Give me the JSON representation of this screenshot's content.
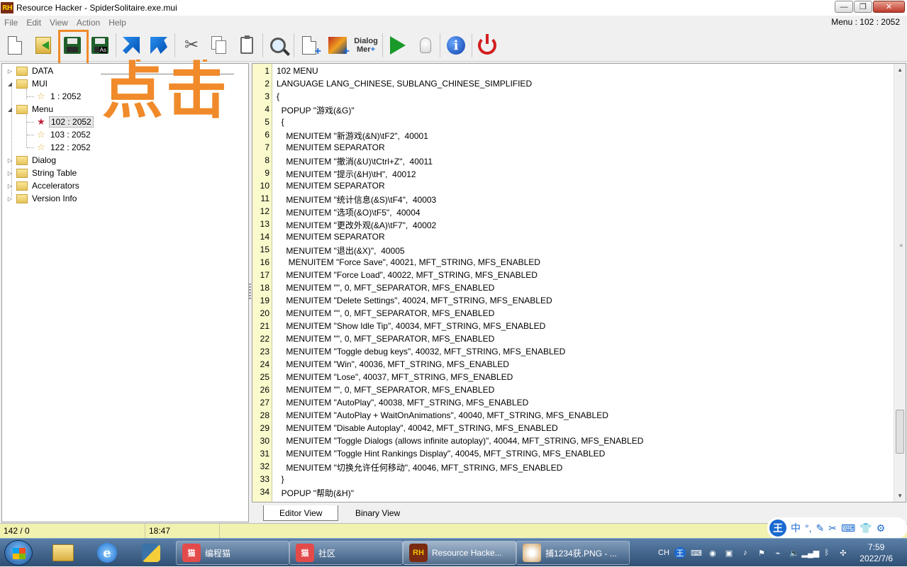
{
  "window": {
    "logo": "RH",
    "title": "Resource Hacker - SpiderSolitaire.exe.mui",
    "minimize": "—",
    "maximize": "❐",
    "close": "✕"
  },
  "menubar": {
    "items": [
      "File",
      "Edit",
      "View",
      "Action",
      "Help"
    ],
    "indicator": "Menu : 102 : 2052"
  },
  "toolbar": {
    "dialog_merge_label_1": "Dialog",
    "dialog_merge_label_2": "Mer",
    "save_as_badge": "As"
  },
  "annotation": {
    "text": "点击",
    "color": "#f08a2a"
  },
  "tree": {
    "nodes": [
      {
        "label": "DATA"
      },
      {
        "label": "MUI"
      },
      {
        "label": "1 : 2052"
      },
      {
        "label": "Menu"
      },
      {
        "label": "102 : 2052"
      },
      {
        "label": "103 : 2052"
      },
      {
        "label": "122 : 2052"
      },
      {
        "label": "Dialog"
      },
      {
        "label": "String Table"
      },
      {
        "label": "Accelerators"
      },
      {
        "label": "Version Info"
      }
    ]
  },
  "editor": {
    "lines": [
      "102 MENU",
      "LANGUAGE LANG_CHINESE, SUBLANG_CHINESE_SIMPLIFIED",
      "{",
      "  POPUP \"游戏(&G)\"",
      "  {",
      "    MENUITEM \"新游戏(&N)\\tF2\",  40001",
      "    MENUITEM SEPARATOR",
      "    MENUITEM \"撤消(&U)\\tCtrl+Z\",  40011",
      "    MENUITEM \"提示(&H)\\tH\",  40012",
      "    MENUITEM SEPARATOR",
      "    MENUITEM \"统计信息(&S)\\tF4\",  40003",
      "    MENUITEM \"选项(&O)\\tF5\",  40004",
      "    MENUITEM \"更改外观(&A)\\tF7\",  40002",
      "    MENUITEM SEPARATOR",
      "    MENUITEM \"退出(&X)\",  40005",
      "     MENUITEM \"Force Save\", 40021, MFT_STRING, MFS_ENABLED",
      "    MENUITEM \"Force Load\", 40022, MFT_STRING, MFS_ENABLED",
      "    MENUITEM \"\", 0, MFT_SEPARATOR, MFS_ENABLED",
      "    MENUITEM \"Delete Settings\", 40024, MFT_STRING, MFS_ENABLED",
      "    MENUITEM \"\", 0, MFT_SEPARATOR, MFS_ENABLED",
      "    MENUITEM \"Show Idle Tip\", 40034, MFT_STRING, MFS_ENABLED",
      "    MENUITEM \"\", 0, MFT_SEPARATOR, MFS_ENABLED",
      "    MENUITEM \"Toggle debug keys\", 40032, MFT_STRING, MFS_ENABLED",
      "    MENUITEM \"Win\", 40036, MFT_STRING, MFS_ENABLED",
      "    MENUITEM \"Lose\", 40037, MFT_STRING, MFS_ENABLED",
      "    MENUITEM \"\", 0, MFT_SEPARATOR, MFS_ENABLED",
      "    MENUITEM \"AutoPlay\", 40038, MFT_STRING, MFS_ENABLED",
      "    MENUITEM \"AutoPlay + WaitOnAnimations\", 40040, MFT_STRING, MFS_ENABLED",
      "    MENUITEM \"Disable Autoplay\", 40042, MFT_STRING, MFS_ENABLED",
      "    MENUITEM \"Toggle Dialogs (allows infinite autoplay)\", 40044, MFT_STRING, MFS_ENABLED",
      "    MENUITEM \"Toggle Hint Rankings Display\", 40045, MFT_STRING, MFS_ENABLED",
      "    MENUITEM \"切换允许任何移动\", 40046, MFT_STRING, MFS_ENABLED",
      "  }",
      "  POPUP \"帮助(&H)\""
    ],
    "tabs": [
      "Editor View",
      "Binary View"
    ]
  },
  "statusbar": {
    "position": "142 / 0",
    "time": "18:47"
  },
  "ime": {
    "logo": "王",
    "lang": "中",
    "punct": "°,",
    "icons": [
      "✎",
      "✂",
      "⌨",
      "👕",
      "⚙"
    ]
  },
  "taskbar": {
    "tasks": [
      {
        "label": "编程猫"
      },
      {
        "label": "社区"
      },
      {
        "label": "Resource Hacke..."
      },
      {
        "label": "捕1234获.PNG - ..."
      }
    ],
    "tray_lang": "CH",
    "time": "7:59",
    "date": "2022/7/6"
  }
}
